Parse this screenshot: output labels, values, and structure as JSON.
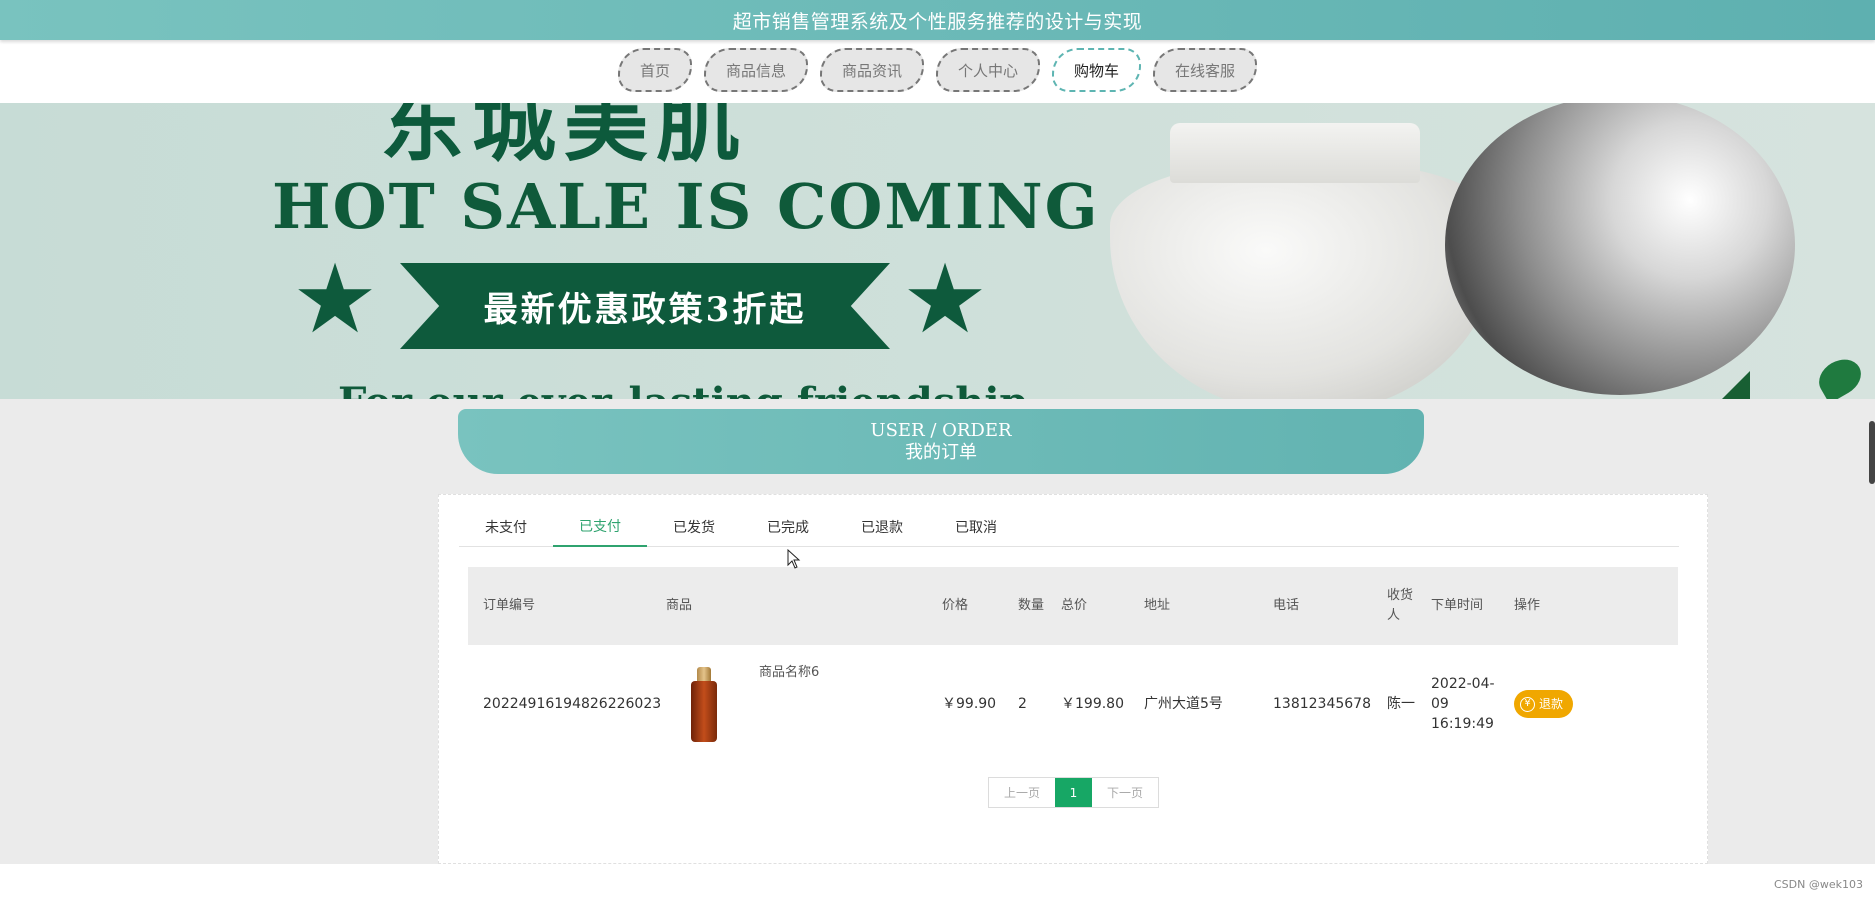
{
  "site": {
    "title": "超市销售管理系统及个性服务推荐的设计与实现"
  },
  "nav": {
    "items": [
      {
        "label": "首页"
      },
      {
        "label": "商品信息"
      },
      {
        "label": "商品资讯"
      },
      {
        "label": "个人中心"
      },
      {
        "label": "购物车",
        "active": true
      },
      {
        "label": "在线客服"
      }
    ]
  },
  "banner": {
    "headline_cn": "东城美肌",
    "headline_en": "HOT SALE IS COMING",
    "ribbon": "最新优惠政策3折起",
    "tagline": "For our ever-lasting friendship"
  },
  "section": {
    "title_en": "USER / ORDER",
    "title_cn": "我的订单"
  },
  "tabs": [
    {
      "label": "未支付"
    },
    {
      "label": "已支付",
      "active": true
    },
    {
      "label": "已发货"
    },
    {
      "label": "已完成"
    },
    {
      "label": "已退款"
    },
    {
      "label": "已取消"
    }
  ],
  "table": {
    "headers": {
      "order_no": "订单编号",
      "goods": "商品",
      "price": "价格",
      "qty": "数量",
      "total": "总价",
      "address": "地址",
      "phone": "电话",
      "receiver": "收货人",
      "time": "下单时间",
      "op": "操作"
    },
    "rows": [
      {
        "order_no": "20224916194826226023",
        "goods_name": "商品名称6",
        "price": "￥99.90",
        "qty": "2",
        "total": "￥199.80",
        "address": "广州大道5号",
        "phone": "13812345678",
        "receiver": "陈一",
        "time": "2022-04-09 16:19:49",
        "action": "退款"
      }
    ]
  },
  "pager": {
    "prev": "上一页",
    "current": "1",
    "next": "下一页"
  },
  "footer": {
    "credit": "CSDN @wek103"
  },
  "colors": {
    "accent": "#62b3b1",
    "active_tab": "#2fa36f",
    "refund": "#f0a700",
    "page_current": "#17a765"
  }
}
